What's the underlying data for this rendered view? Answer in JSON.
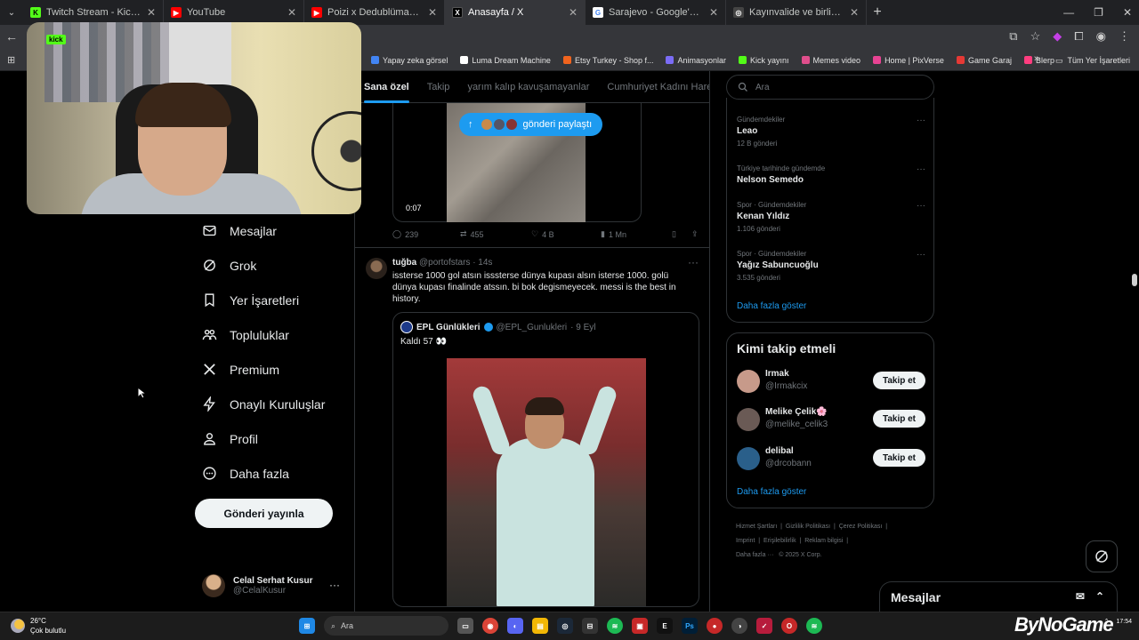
{
  "browser": {
    "tabs": [
      {
        "label": "Twitch Stream - Kick Dashboard",
        "color": "#53fc18",
        "glyph": "K"
      },
      {
        "label": "YouTube",
        "color": "#ff0000",
        "glyph": "▶"
      },
      {
        "label": "Poizi x Dedublüman - GAMZEDE",
        "color": "#ff0000",
        "glyph": "▶"
      },
      {
        "label": "Anasayfa / X",
        "color": "#000000",
        "glyph": "X",
        "active": true
      },
      {
        "label": "Sarajevo - Google'da Ara",
        "color": "#ffffff",
        "glyph": "G"
      },
      {
        "label": "Kayınvalide ve birlikte kaçtığı d",
        "color": "#444444",
        "glyph": "◎"
      }
    ],
    "bookmarks": [
      {
        "label": "Yapay zeka görsel",
        "color": "#4285f4"
      },
      {
        "label": "Luma Dream Machine",
        "color": "#ffffff"
      },
      {
        "label": "Etsy Turkey - Shop f...",
        "color": "#f1641e"
      },
      {
        "label": "Animasyonlar",
        "color": "#7b6cf6"
      },
      {
        "label": "Kick yayını",
        "color": "#53fc18"
      },
      {
        "label": "Memes video",
        "color": "#e04e8c"
      },
      {
        "label": "Home | PixVerse",
        "color": "#e84393"
      },
      {
        "label": "Game Garaj",
        "color": "#e53935"
      },
      {
        "label": "Blerp",
        "color": "#ff3d7f"
      }
    ],
    "bookmarks_all": "Tüm Yer İşaretleri"
  },
  "sidebar": {
    "items": [
      {
        "label": "Mesajlar",
        "icon": "mail-icon"
      },
      {
        "label": "Grok",
        "icon": "grok-icon"
      },
      {
        "label": "Yer İşaretleri",
        "icon": "bookmark-icon"
      },
      {
        "label": "Topluluklar",
        "icon": "communities-icon"
      },
      {
        "label": "Premium",
        "icon": "x-logo-icon"
      },
      {
        "label": "Onaylı Kuruluşlar",
        "icon": "lightning-icon"
      },
      {
        "label": "Profil",
        "icon": "person-icon"
      },
      {
        "label": "Daha fazla",
        "icon": "more-circle-icon"
      }
    ],
    "post_button": "Gönderi yayınla",
    "profile": {
      "name": "Celal Serhat Kusur",
      "handle": "@CelalKusur"
    }
  },
  "feed": {
    "tabs": [
      "Sana özel",
      "Takip",
      "yarım kalıp kavuşamayanlar",
      "Cumhuriyet Kadını Hareke"
    ],
    "pill_label": "gönderi paylaştı",
    "video_time": "0:07",
    "post_actions": {
      "replies": "239",
      "reposts": "455",
      "likes": "4 B",
      "views": "1 Mn"
    },
    "tweet": {
      "name": "tuğba",
      "handle": "@portofstars",
      "time": "· 14s",
      "text": "issterse 1000 gol atsın isssterse dünya kupası alsın isterse 1000. golü dünya kupası finalinde atssın. bi bok degismeyecek. messi is the best in history.",
      "quote": {
        "name": "EPL Günlükleri",
        "handle": "@EPL_Gunlukleri",
        "time": "· 9 Eyl",
        "text": "Kaldı 57 👀"
      }
    }
  },
  "right": {
    "search_placeholder": "Ara",
    "trends": [
      {
        "context": "Gündemdekiler",
        "title": "Leao",
        "count": "12 B gönderi"
      },
      {
        "context": "Türkiye tarihinde gündemde",
        "title": "Nelson Semedo",
        "count": ""
      },
      {
        "context": "Spor · Gündemdekiler",
        "title": "Kenan Yıldız",
        "count": "1.106 gönderi"
      },
      {
        "context": "Spor · Gündemdekiler",
        "title": "Yağız Sabuncuoğlu",
        "count": "3.535 gönderi"
      }
    ],
    "show_more": "Daha fazla göster",
    "who_to_follow": {
      "title": "Kimi takip etmeli",
      "accounts": [
        {
          "name": "Irmak",
          "handle": "@Irmakcix",
          "color": "#c79a8a"
        },
        {
          "name": "Melike Çelik🌸",
          "handle": "@melike_celik3",
          "color": "#6a5a55"
        },
        {
          "name": "delibal",
          "handle": "@drcobann",
          "color": "#2a5f8a"
        }
      ],
      "follow_label": "Takip et",
      "show_more": "Daha fazla göster"
    },
    "footer": {
      "line1": [
        "Hizmet Şartları",
        "Gizlilik Politikası",
        "Çerez Politikası"
      ],
      "line2": [
        "Imprint",
        "Erişilebilirlik",
        "Reklam bilgisi"
      ],
      "more": "Daha fazla ···",
      "copyright": "© 2025 X Corp."
    },
    "messages_drawer": "Mesajlar"
  },
  "taskbar": {
    "temp": "26°C",
    "weather": "Çok bulutlu",
    "search_label": "Ara",
    "clock": "17:54"
  },
  "overlay": {
    "brand": "ByNoGame",
    "kick_badge": "kick"
  }
}
